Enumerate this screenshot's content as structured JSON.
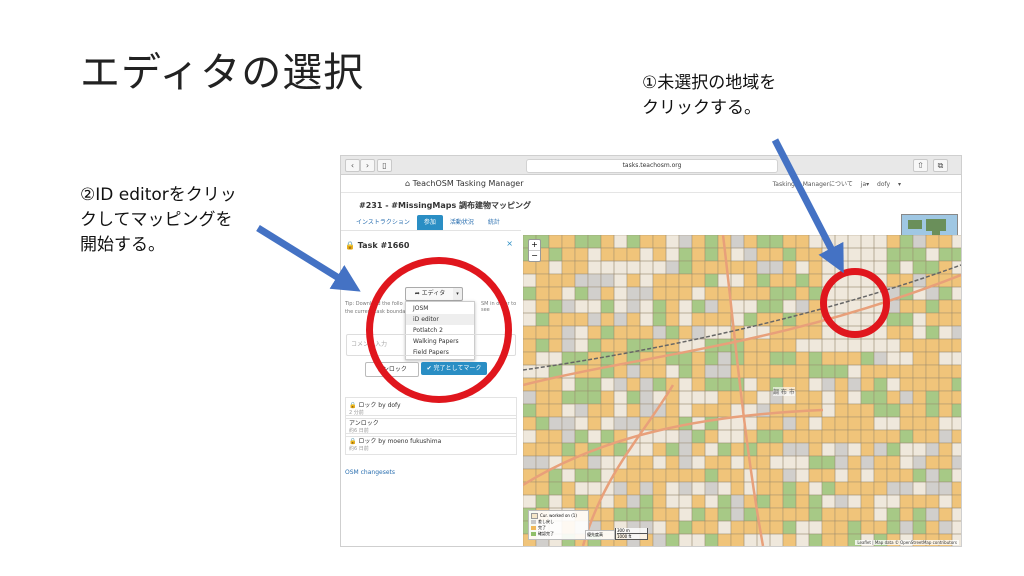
{
  "slide": {
    "title": "エディタの選択",
    "note1": "①未選択の地域を\nクリックする。",
    "note2": "②ID editorをクリッ\nクしてマッピングを\n開始する。"
  },
  "browser": {
    "url": "tasks.teachosm.org"
  },
  "app": {
    "brand": "TeachOSM Tasking Manager",
    "header_right": "Tasking Managerについて  ja▾  dofy ▾",
    "project_title": "#231 - #MissingMaps 調布建物マッピング",
    "tabs": [
      "インストラクション",
      "参加",
      "活動状況",
      "統計"
    ]
  },
  "task": {
    "title": "Task #1660",
    "close": "×",
    "editor_button": "エディタ",
    "editor_options": [
      "JOSM",
      "iD editor",
      "Potlatch 2",
      "Walking Papers",
      "Field Papers"
    ],
    "tip_line1": "Tip: Download the follo",
    "tip_line1b": "SM in order to see",
    "tip_line2": "the current task boundary",
    "comment_placeholder": "コメント入力",
    "unlock_button": "アンロック",
    "done_button": "完了としてマーク",
    "history": [
      {
        "action": "ロック by dofy",
        "date": "2 分前"
      },
      {
        "action": "アンロック",
        "date": "約6 日前"
      },
      {
        "action": "ロック by moeno fukushima",
        "date": "約6 日前"
      }
    ],
    "osm_link": "OSM changesets"
  },
  "map": {
    "place_label": "調 布 市",
    "legend": [
      "Cur. worked on (1)",
      "差し戻し",
      "完了",
      "確認完了"
    ],
    "legend_colors": [
      "#f5e6c8",
      "#c7c7c7",
      "#f0b85a",
      "#8fbf6a"
    ],
    "legend_extra": "優先度高",
    "scale": [
      "300 m",
      "1000 ft"
    ],
    "attribution": "Leaflet | Map data © OpenStreetMap contributors"
  },
  "colors": {
    "annotation_ring": "#e0161d",
    "arrow": "#4472c4",
    "primary": "#2a8ec4"
  }
}
